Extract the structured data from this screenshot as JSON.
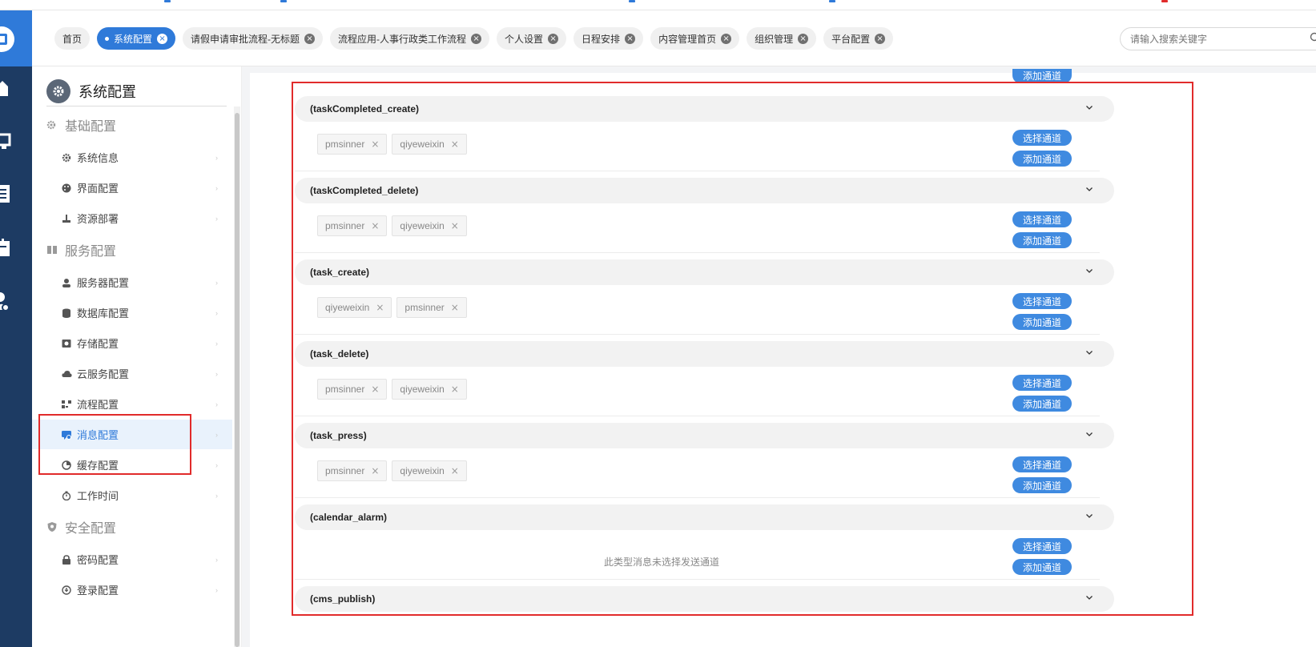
{
  "header": {
    "tabs": [
      {
        "label": "首页",
        "closable": false,
        "active": false
      },
      {
        "label": "系统配置",
        "closable": true,
        "active": true
      },
      {
        "label": "请假申请审批流程-无标题",
        "closable": true,
        "active": false
      },
      {
        "label": "流程应用-人事行政类工作流程",
        "closable": true,
        "active": false
      },
      {
        "label": "个人设置",
        "closable": true,
        "active": false
      },
      {
        "label": "日程安排",
        "closable": true,
        "active": false
      },
      {
        "label": "内容管理首页",
        "closable": true,
        "active": false
      },
      {
        "label": "组织管理",
        "closable": true,
        "active": false
      },
      {
        "label": "平台配置",
        "closable": true,
        "active": false
      }
    ],
    "search_placeholder": "请输入搜索关键字"
  },
  "sidebar": {
    "title": "系统配置",
    "groups": [
      {
        "label": "基础配置",
        "icon": "gear-icon",
        "items": [
          {
            "label": "系统信息",
            "icon": "gear-icon"
          },
          {
            "label": "界面配置",
            "icon": "palette-icon"
          },
          {
            "label": "资源部署",
            "icon": "deploy-icon"
          }
        ]
      },
      {
        "label": "服务配置",
        "icon": "server-icon",
        "items": [
          {
            "label": "服务器配置",
            "icon": "user-cog-icon"
          },
          {
            "label": "数据库配置",
            "icon": "database-icon"
          },
          {
            "label": "存储配置",
            "icon": "storage-icon"
          },
          {
            "label": "云服务配置",
            "icon": "cloud-icon"
          },
          {
            "label": "流程配置",
            "icon": "flow-icon"
          },
          {
            "label": "消息配置",
            "icon": "message-icon",
            "active": true
          },
          {
            "label": "缓存配置",
            "icon": "pie-icon"
          },
          {
            "label": "工作时间",
            "icon": "timer-icon"
          }
        ]
      },
      {
        "label": "安全配置",
        "icon": "shield-icon",
        "items": [
          {
            "label": "密码配置",
            "icon": "lock-icon"
          },
          {
            "label": "登录配置",
            "icon": "login-icon"
          }
        ]
      }
    ]
  },
  "main": {
    "partial_top_button": "添加通道",
    "select_label": "选择通道",
    "add_label": "添加通道",
    "sections": [
      {
        "title": "(taskCompleted_create)",
        "channels": [
          "pmsinner",
          "qiyeweixin"
        ]
      },
      {
        "title": "(taskCompleted_delete)",
        "channels": [
          "pmsinner",
          "qiyeweixin"
        ]
      },
      {
        "title": "(task_create)",
        "channels": [
          "qiyeweixin",
          "pmsinner"
        ]
      },
      {
        "title": "(task_delete)",
        "channels": [
          "pmsinner",
          "qiyeweixin"
        ]
      },
      {
        "title": "(task_press)",
        "channels": [
          "pmsinner",
          "qiyeweixin"
        ]
      },
      {
        "title": "(calendar_alarm)",
        "channels": [],
        "empty_note": "此类型消息未选择发送通道"
      },
      {
        "title": "(cms_publish)",
        "channels": []
      }
    ]
  },
  "colors": {
    "primary": "#2f7ad9",
    "button": "#3f8ae0",
    "rail": "#1d3b63",
    "annotation": "#e12b2b"
  }
}
